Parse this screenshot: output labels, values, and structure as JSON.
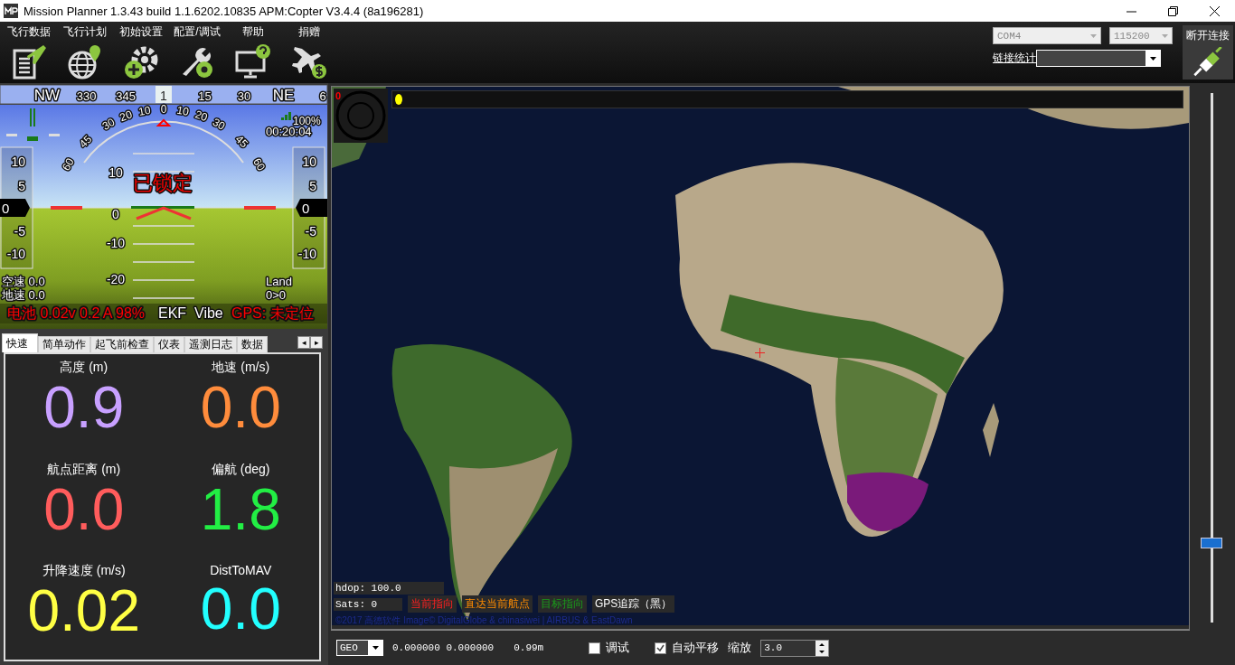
{
  "window": {
    "title": "Mission Planner 1.3.43 build 1.1.6202.10835 APM:Copter V3.4.4 (8a196281)"
  },
  "menu": [
    {
      "label": "飞行数据",
      "kind": "flightdata"
    },
    {
      "label": "飞行计划",
      "kind": "flightplan"
    },
    {
      "label": "初始设置",
      "kind": "setup"
    },
    {
      "label": "配置/调试",
      "kind": "config"
    },
    {
      "label": "帮助",
      "kind": "help"
    },
    {
      "label": "捐赠",
      "kind": "donate"
    }
  ],
  "connection": {
    "port": "COM4",
    "baud": "115200",
    "stats_label": "链接统计",
    "connect_label": "断开连接"
  },
  "hud": {
    "heading_labels": [
      "NW",
      "330",
      "345",
      "1",
      "15",
      "30",
      "NE",
      "6"
    ],
    "roll_labels": [
      "60",
      "45",
      "30",
      "20",
      "10",
      "0",
      "10",
      "20",
      "30",
      "45",
      "60"
    ],
    "pitch_labels": [
      "10",
      "0",
      "-10",
      "-20"
    ],
    "speed_tape": [
      "10",
      "5",
      "-5",
      "-10"
    ],
    "speed_value": "0",
    "alt_tape": [
      "10",
      "5",
      "-5",
      "-10"
    ],
    "alt_value": "0",
    "armed_status": "已锁定",
    "battery_remaining": "100%",
    "timer": "00:20:04",
    "airspeed": "空速 0.0",
    "groundspeed": "地速 0.0",
    "mode": "Land",
    "waypoint": "0>0",
    "battery": "电池 0.02v 0.2 A 98%",
    "ekf": "EKF",
    "vibe": "Vibe",
    "gps": "GPS: 未定位"
  },
  "tabs": [
    {
      "label": "快速",
      "selected": true
    },
    {
      "label": "简单动作",
      "selected": false
    },
    {
      "label": "起飞前检查",
      "selected": false
    },
    {
      "label": "仪表",
      "selected": false
    },
    {
      "label": "遥测日志",
      "selected": false
    },
    {
      "label": "数据",
      "selected": false
    }
  ],
  "tab_scroll": [
    "◂",
    "▸"
  ],
  "quick": [
    {
      "label": "高度 (m)",
      "value": "0.9",
      "color": "#c8a0ff"
    },
    {
      "label": "地速 (m/s)",
      "value": "0.0",
      "color": "#ff8c3c"
    },
    {
      "label": "航点距离 (m)",
      "value": "0.0",
      "color": "#ff5c5c"
    },
    {
      "label": "偏航 (deg)",
      "value": "1.8",
      "color": "#22ee44"
    },
    {
      "label": "升降速度 (m/s)",
      "value": "0.02",
      "color": "#ffff44"
    },
    {
      "label": "DistToMAV",
      "value": "0.0",
      "color": "#22ffff"
    }
  ],
  "map": {
    "compass_heading": "0",
    "hdop": "hdop: 100.0",
    "sats": "Sats: 0",
    "legend": [
      {
        "label": "当前指向",
        "kind": "heading"
      },
      {
        "label": "直达当前航点",
        "kind": "waypoint"
      },
      {
        "label": "目标指向",
        "kind": "target"
      },
      {
        "label": "GPS追踪（黑）",
        "kind": "gps"
      }
    ],
    "attribution": "©2017 高德软件 Image© DigitalGlobe & chinasiwei | AIRBUS & EastDawn",
    "zoom_slider": {
      "level": 0.15
    }
  },
  "bottom_bar": {
    "coord_system": "GEO",
    "coordinates": "0.000000 0.000000",
    "altitude": "0.99m",
    "debug": {
      "label": "调试",
      "checked": false
    },
    "auto_pan": {
      "label": "自动平移",
      "checked": true
    },
    "zoom_label": "缩放",
    "zoom_value": "3.0"
  }
}
